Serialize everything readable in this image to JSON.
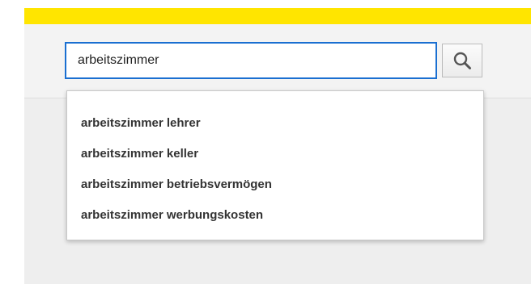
{
  "search": {
    "value": "arbeitszimmer",
    "button_icon": "search-icon"
  },
  "suggestions": [
    {
      "label": "arbeitszimmer lehrer"
    },
    {
      "label": "arbeitszimmer keller"
    },
    {
      "label": "arbeitszimmer betriebsvermögen"
    },
    {
      "label": "arbeitszimmer werbungskosten"
    }
  ],
  "colors": {
    "top_bar": "#ffe500",
    "input_focus_border": "#1a6fd1",
    "header_background": "#f3f3f3",
    "content_background": "#eeeeee",
    "suggestion_text": "#333333"
  }
}
